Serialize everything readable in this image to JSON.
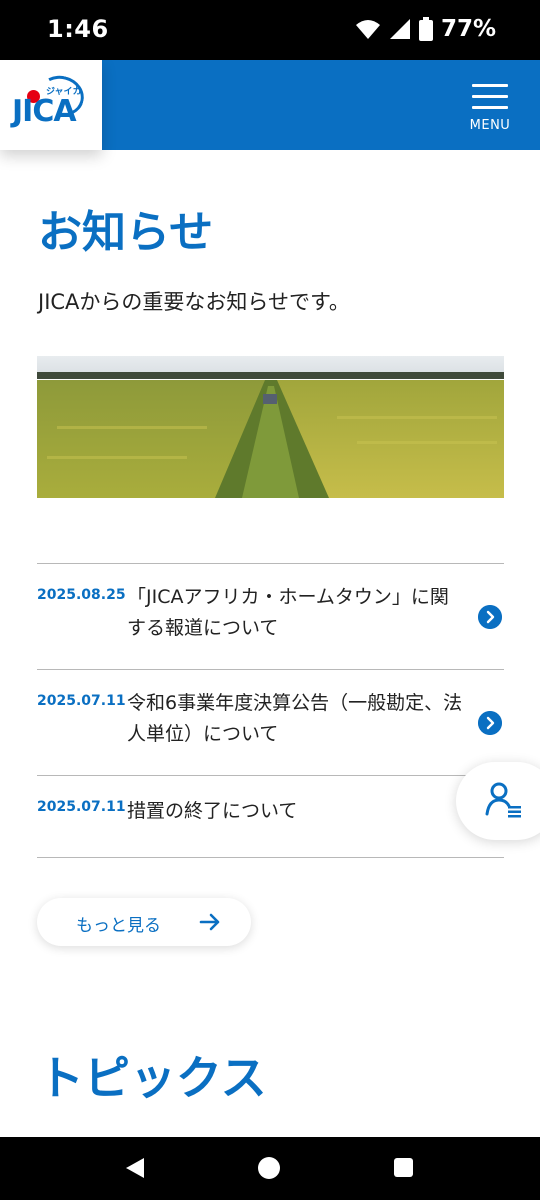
{
  "status_bar": {
    "time": "1:46",
    "battery": "77%",
    "icons": [
      "wifi-icon",
      "cell-signal-icon",
      "battery-icon"
    ]
  },
  "header": {
    "logo_text": "JICA",
    "logo_kana": "ジャイカ",
    "menu_label": "MENU",
    "brand_color": "#0a6fc2",
    "logo_dot_color": "#e60012"
  },
  "main": {
    "title": "お知らせ",
    "description": "JICAからの重要なお知らせです。",
    "hero_image": "rice-field-photo",
    "news": [
      {
        "date": "2025.08.25",
        "text": "「JICAアフリカ・ホームタウン」に関する報道について"
      },
      {
        "date": "2025.07.11",
        "text": "令和6事業年度決算公告（一般勘定、法人単位）について"
      },
      {
        "date": "2025.07.11",
        "text": "措置の終了について"
      }
    ],
    "more_label": "もっと見る",
    "topics_title": "トピックス"
  },
  "nav_bar": {
    "icons": [
      "back-icon",
      "home-icon",
      "recents-icon"
    ]
  }
}
